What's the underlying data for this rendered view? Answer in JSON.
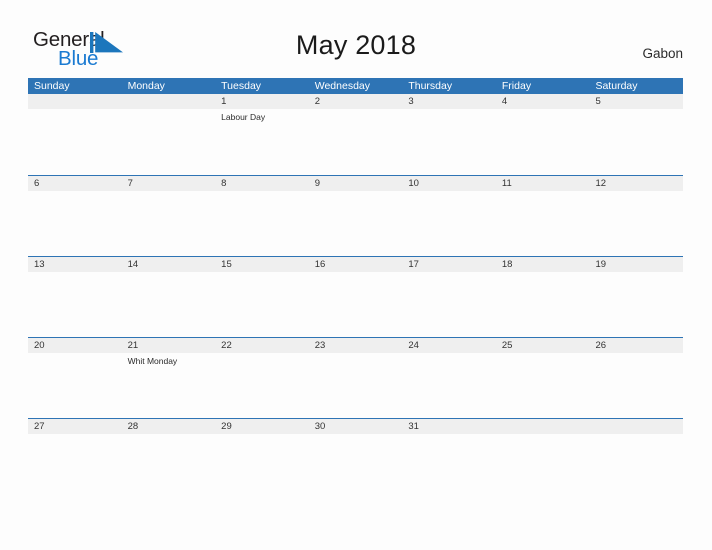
{
  "header": {
    "logo": {
      "line1": "General",
      "line2": "Blue",
      "icon": "blue-flag-triangle",
      "line1_color": "#231f20",
      "line2_color": "#1a7ad1",
      "flag_color": "#1c76bc"
    },
    "title": "May 2018",
    "country": "Gabon"
  },
  "calendar": {
    "accent_color": "#2e74b5",
    "date_band_color": "#efefef",
    "weekdays": [
      "Sunday",
      "Monday",
      "Tuesday",
      "Wednesday",
      "Thursday",
      "Friday",
      "Saturday"
    ],
    "weeks": [
      {
        "days": [
          {
            "date": "",
            "event": ""
          },
          {
            "date": "",
            "event": ""
          },
          {
            "date": "1",
            "event": "Labour Day"
          },
          {
            "date": "2",
            "event": ""
          },
          {
            "date": "3",
            "event": ""
          },
          {
            "date": "4",
            "event": ""
          },
          {
            "date": "5",
            "event": ""
          }
        ]
      },
      {
        "days": [
          {
            "date": "6",
            "event": ""
          },
          {
            "date": "7",
            "event": ""
          },
          {
            "date": "8",
            "event": ""
          },
          {
            "date": "9",
            "event": ""
          },
          {
            "date": "10",
            "event": ""
          },
          {
            "date": "11",
            "event": ""
          },
          {
            "date": "12",
            "event": ""
          }
        ]
      },
      {
        "days": [
          {
            "date": "13",
            "event": ""
          },
          {
            "date": "14",
            "event": ""
          },
          {
            "date": "15",
            "event": ""
          },
          {
            "date": "16",
            "event": ""
          },
          {
            "date": "17",
            "event": ""
          },
          {
            "date": "18",
            "event": ""
          },
          {
            "date": "19",
            "event": ""
          }
        ]
      },
      {
        "days": [
          {
            "date": "20",
            "event": ""
          },
          {
            "date": "21",
            "event": "Whit Monday"
          },
          {
            "date": "22",
            "event": ""
          },
          {
            "date": "23",
            "event": ""
          },
          {
            "date": "24",
            "event": ""
          },
          {
            "date": "25",
            "event": ""
          },
          {
            "date": "26",
            "event": ""
          }
        ]
      },
      {
        "days": [
          {
            "date": "27",
            "event": ""
          },
          {
            "date": "28",
            "event": ""
          },
          {
            "date": "29",
            "event": ""
          },
          {
            "date": "30",
            "event": ""
          },
          {
            "date": "31",
            "event": ""
          },
          {
            "date": "",
            "event": ""
          },
          {
            "date": "",
            "event": ""
          }
        ]
      }
    ]
  }
}
